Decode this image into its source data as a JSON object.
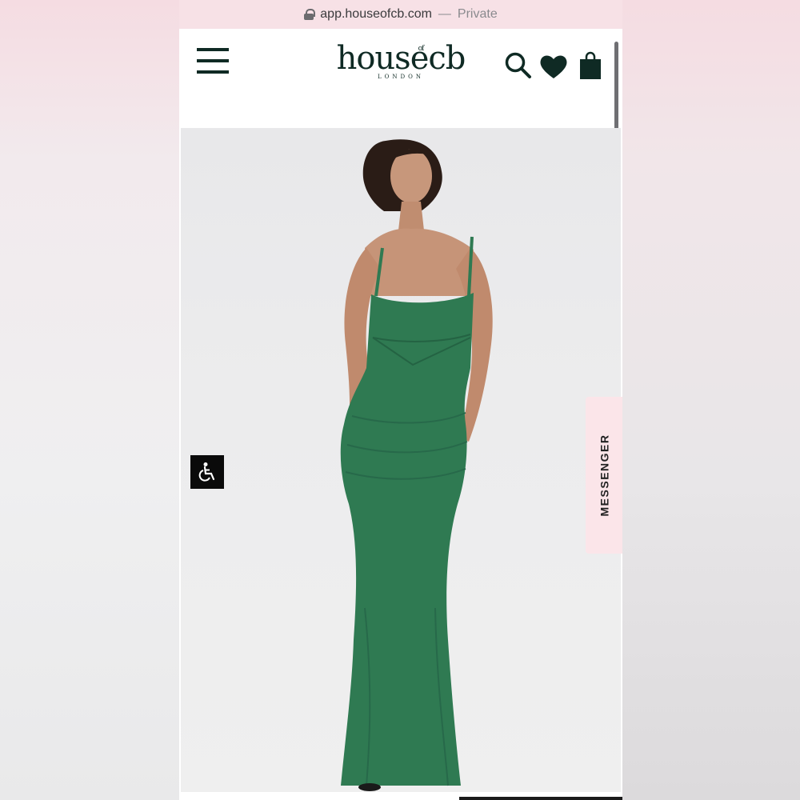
{
  "browser": {
    "url": "app.houseofcb.com",
    "separator": "—",
    "mode": "Private"
  },
  "header": {
    "logo": {
      "brand": "houseᵒᶠcb",
      "brand_main": "house",
      "brand_of": "of",
      "brand_end": "cb",
      "location": "LONDON"
    },
    "icons": [
      "menu-icon",
      "search-icon",
      "heart-icon",
      "bag-icon"
    ]
  },
  "hero": {
    "dress_color": "#2f7a52",
    "background_color": "#ececed"
  },
  "widgets": {
    "accessibility_icon": "wheelchair-icon",
    "messenger_label": "MESSENGER"
  },
  "colors": {
    "brand": "#0f2a24",
    "messenger_tab": "#fbe5e9",
    "url_bar": "#f7e1e6"
  }
}
